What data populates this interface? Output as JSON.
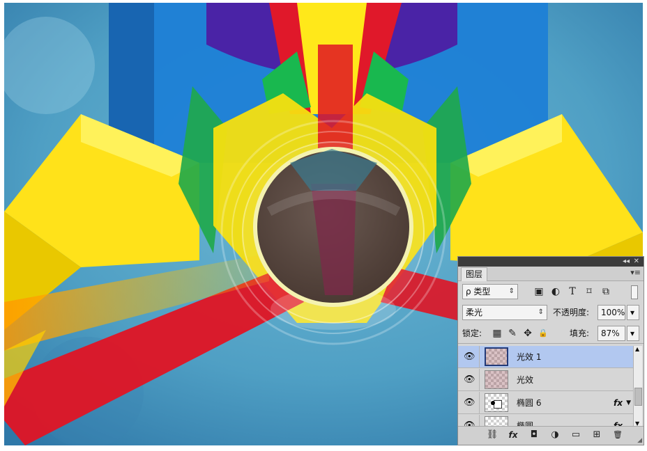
{
  "panel": {
    "collapse_glyph": "◂◂",
    "close_glyph": "✕",
    "tab_label": "图层",
    "menu_glyph": "▾≡",
    "filter": {
      "label": "ρ 类型",
      "spin": "⇕"
    },
    "filter_icons": {
      "image": "▣",
      "adjust": "◐",
      "text": "T",
      "shape": "⌑",
      "smart": "⧉"
    },
    "blend_mode": "柔光",
    "opacity_label": "不透明度:",
    "opacity_value": "100%",
    "lock_label": "锁定:",
    "lock_icons": {
      "pixels": "▦",
      "brush": "✎",
      "move": "✥",
      "all": "🔒"
    },
    "fill_label": "填充:",
    "fill_value": "87%",
    "dropdown_glyph": "▾"
  },
  "layers": [
    {
      "name": "光效 1",
      "selected": true,
      "fx": ""
    },
    {
      "name": "光效",
      "selected": false,
      "fx": ""
    },
    {
      "name": "椭圆 6",
      "selected": false,
      "fx": "fx"
    },
    {
      "name": "椭圆",
      "selected": false,
      "fx": "fx"
    }
  ],
  "bottom_icons": {
    "link": "⛓",
    "fx": "fx",
    "mask": "◘",
    "adjustment": "◑",
    "group": "▭",
    "new": "⊞",
    "trash": "🗑"
  },
  "colors": {
    "selected_row": "#b2c8f0",
    "panel_bg": "#d6d6d6"
  }
}
